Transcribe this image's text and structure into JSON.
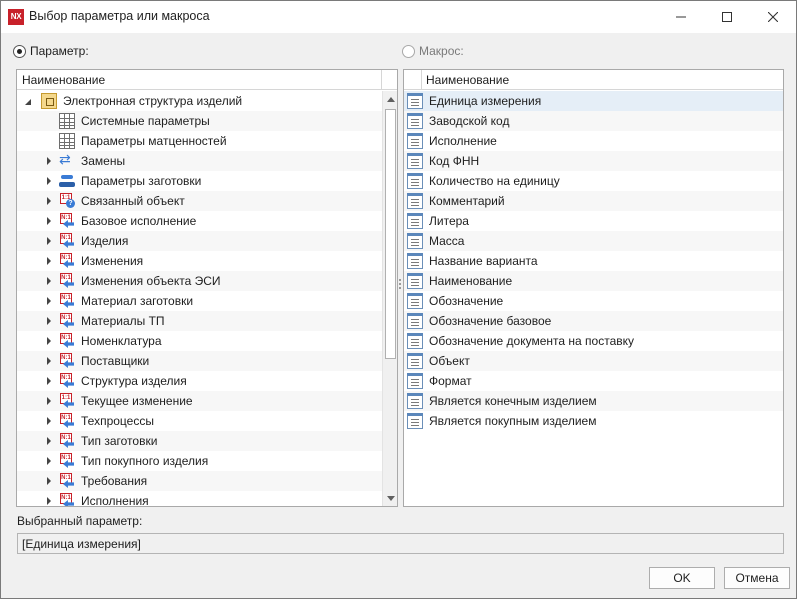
{
  "window": {
    "app_icon_text": "NX",
    "title": "Выбор параметра или макроса"
  },
  "modes": {
    "parameter": {
      "label": "Параметр:",
      "checked": true
    },
    "macro": {
      "label": "Макрос:",
      "checked": false
    }
  },
  "left_panel": {
    "column_header": "Наименование",
    "items": [
      {
        "label": "Электронная структура изделий",
        "level": 0,
        "expander": "expanded",
        "icon": "package-icon"
      },
      {
        "label": "Системные параметры",
        "level": 1,
        "expander": "none",
        "icon": "table-icon"
      },
      {
        "label": "Параметры матценностей",
        "level": 1,
        "expander": "none",
        "icon": "table-icon"
      },
      {
        "label": "Замены",
        "level": 1,
        "expander": "collapsed",
        "icon": "swap-icon"
      },
      {
        "label": "Параметры заготовки",
        "level": 1,
        "expander": "collapsed",
        "icon": "stack-icon"
      },
      {
        "label": "Связанный объект",
        "level": 1,
        "expander": "collapsed",
        "icon": "linked-object-icon"
      },
      {
        "label": "Базовое исполнение",
        "level": 1,
        "expander": "collapsed",
        "icon": "relation-n1-icon"
      },
      {
        "label": "Изделия",
        "level": 1,
        "expander": "collapsed",
        "icon": "relation-n1-icon"
      },
      {
        "label": "Изменения",
        "level": 1,
        "expander": "collapsed",
        "icon": "relation-n1-icon"
      },
      {
        "label": "Изменения объекта ЭСИ",
        "level": 1,
        "expander": "collapsed",
        "icon": "relation-n1-icon"
      },
      {
        "label": "Материал заготовки",
        "level": 1,
        "expander": "collapsed",
        "icon": "relation-n1-icon"
      },
      {
        "label": "Материалы ТП",
        "level": 1,
        "expander": "collapsed",
        "icon": "relation-n1-icon"
      },
      {
        "label": "Номенклатура",
        "level": 1,
        "expander": "collapsed",
        "icon": "relation-n1-icon"
      },
      {
        "label": "Поставщики",
        "level": 1,
        "expander": "collapsed",
        "icon": "relation-n1-icon"
      },
      {
        "label": "Структура изделия",
        "level": 1,
        "expander": "collapsed",
        "icon": "relation-n1-icon"
      },
      {
        "label": "Текущее изменение",
        "level": 1,
        "expander": "collapsed",
        "icon": "relation-11-icon"
      },
      {
        "label": "Техпроцессы",
        "level": 1,
        "expander": "collapsed",
        "icon": "relation-n1-icon"
      },
      {
        "label": "Тип заготовки",
        "level": 1,
        "expander": "collapsed",
        "icon": "relation-n1-icon"
      },
      {
        "label": "Тип покупного изделия",
        "level": 1,
        "expander": "collapsed",
        "icon": "relation-n1-icon"
      },
      {
        "label": "Требования",
        "level": 1,
        "expander": "collapsed",
        "icon": "relation-n1-icon"
      },
      {
        "label": "Исполнения",
        "level": 1,
        "expander": "collapsed",
        "icon": "relation-n1-icon"
      }
    ]
  },
  "right_panel": {
    "column_header": "Наименование",
    "items": [
      "Единица измерения",
      "Заводской код",
      "Исполнение",
      "Код ФНН",
      "Количество на единицу",
      "Комментарий",
      "Литера",
      "Масса",
      "Название варианта",
      "Наименование",
      "Обозначение",
      "Обозначение базовое",
      "Обозначение документа на поставку",
      "Объект",
      "Формат",
      "Является конечным изделием",
      "Является покупным изделием"
    ],
    "selected_index": 0
  },
  "selection": {
    "label": "Выбранный параметр:",
    "value": "[Единица измерения]"
  },
  "buttons": {
    "ok": "OK",
    "cancel": "Отмена"
  },
  "colors": {
    "selection_bg": "#e5eef7",
    "brand_red": "#c8212a",
    "accent_blue": "#3a7bd5"
  }
}
